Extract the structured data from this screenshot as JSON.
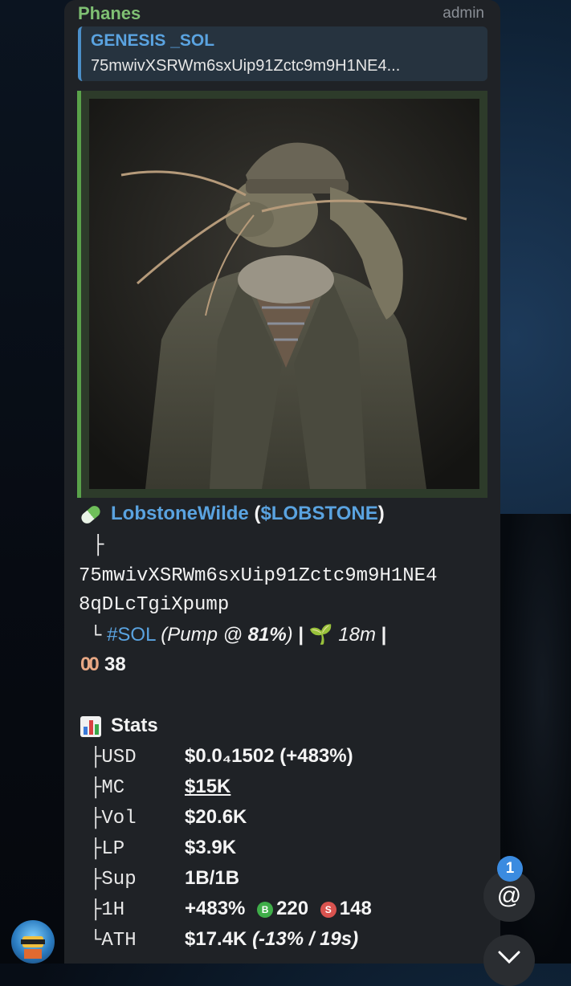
{
  "message": {
    "sender": "Phanes",
    "role": "admin",
    "quote": {
      "title": "GENESIS _SOL",
      "text": "75mwivXSRWm6sxUip91Zctc9m9H1NE4..."
    },
    "token": {
      "icon": "pill-emoji",
      "name": "LobstoneWilde",
      "ticker": "$LOBSTONE",
      "tree_branch": "├",
      "address_line1": "75mwivXSRWm6sxUip91Zctc9m9H1NE4",
      "address_line2": "8qDLcTgiXpump",
      "tree_end": "└",
      "chain_tag": "#SOL",
      "pump_prefix": "(Pump @ ",
      "pump_pct": "81%",
      "pump_suffix": ")",
      "sep": "|",
      "age_icon": "seedling-emoji",
      "age": "18m",
      "eyes_icon": "eyes-emoji",
      "eyes_count": "38"
    },
    "stats": {
      "icon": "bar-chart-emoji",
      "title": "Stats",
      "rows": [
        {
          "branch": "├",
          "label": "USD",
          "value": "$0.0₄1502 (+483%)"
        },
        {
          "branch": "├",
          "label": "MC",
          "value": "$15K"
        },
        {
          "branch": "├",
          "label": "Vol",
          "value": "$20.6K"
        },
        {
          "branch": "├",
          "label": "LP",
          "value": "$3.9K"
        },
        {
          "branch": "├",
          "label": "Sup",
          "value": "1B/1B"
        },
        {
          "branch": "├",
          "label": "1H",
          "value": "+483%",
          "buys_icon": "B",
          "buys": "220",
          "sells_icon": "S",
          "sells": "148"
        },
        {
          "branch": "└",
          "label": "ATH",
          "value": "$17.4K",
          "value_suffix": "(-13% / 19s)"
        }
      ]
    }
  },
  "mention": {
    "badge": "1",
    "symbol": "@"
  },
  "colors": {
    "sender": "#7fc073",
    "link": "#5aa3e0",
    "bubble": "#1f2226",
    "buy": "#3fae49",
    "sell": "#d9534f"
  }
}
